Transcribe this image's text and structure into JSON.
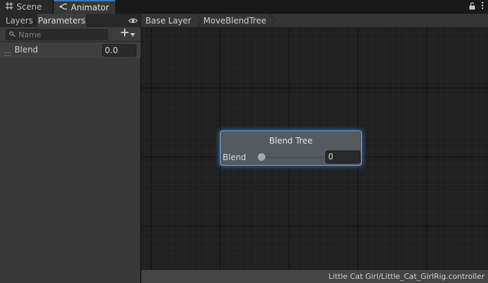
{
  "tabs": {
    "scene_label": "Scene",
    "animator_label": "Animator"
  },
  "left_panel": {
    "tab_layers": "Layers",
    "tab_parameters": "Parameters",
    "search_placeholder": "Name",
    "parameters": [
      {
        "name": "Blend",
        "value": "0.0"
      }
    ]
  },
  "breadcrumb": [
    "Base Layer",
    "MoveBlendTree"
  ],
  "node": {
    "title": "Blend Tree",
    "param_label": "Blend",
    "slider_value": 0,
    "value": "0"
  },
  "status": {
    "controller_path": "Little Cat Girl/Little_Cat_GirlRig.controller"
  },
  "colors": {
    "accent": "#3a79bb",
    "node_border": "#6aa7df",
    "node_bg": "#555a60",
    "panel_bg": "#383838",
    "graph_bg": "#202020"
  },
  "icons": {
    "scene_tab": "grid-icon",
    "animator_tab": "animator-icon",
    "lock": "lock-icon",
    "menu": "kebab-menu-icon",
    "visibility": "eye-icon",
    "search": "search-icon",
    "add": "plus-icon",
    "dropdown": "caret-down-icon",
    "drag": "drag-handle-icon"
  }
}
